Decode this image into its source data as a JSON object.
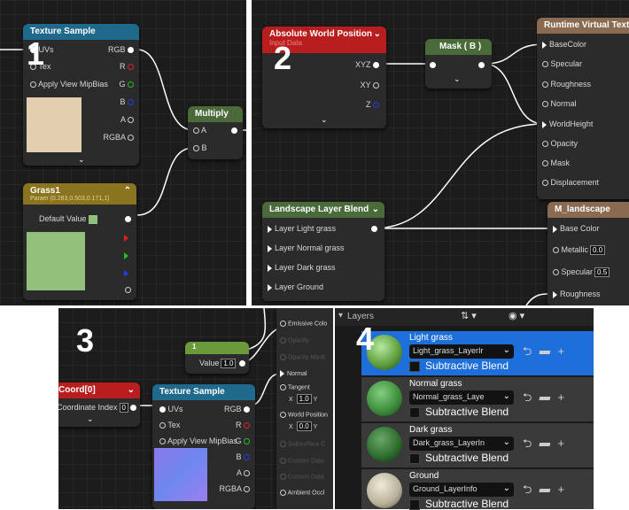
{
  "labels": {
    "p1": "1",
    "p2": "2",
    "p3": "3",
    "p4": "4"
  },
  "panel1": {
    "texture_sample": {
      "title": "Texture Sample",
      "inputs": [
        "UVs",
        "Tex",
        "Apply View MipBias"
      ],
      "outputs": [
        "RGB",
        "R",
        "G",
        "B",
        "A",
        "RGBA"
      ]
    },
    "multiply": {
      "title": "Multiply",
      "inputs": [
        "A",
        "B"
      ]
    },
    "grass1": {
      "title": "Grass1",
      "subtitle": "Param (0.283,0.503,0.171,1)",
      "default_label": "Default Value"
    }
  },
  "panel2": {
    "abs_world_pos": {
      "title": "Absolute World Position",
      "subtitle": "Input Data",
      "outputs": [
        "XYZ",
        "XY",
        "Z"
      ]
    },
    "mask": {
      "title": "Mask ( B )"
    },
    "rvt": {
      "title": "Runtime Virtual Texture",
      "pins": [
        "BaseColor",
        "Specular",
        "Roughness",
        "Normal",
        "WorldHeight",
        "Opacity",
        "Mask",
        "Displacement"
      ]
    },
    "llb": {
      "title": "Landscape Layer Blend",
      "pins": [
        "Layer Light grass",
        "Layer Normal grass",
        "Layer Dark grass",
        "Layer Ground"
      ]
    },
    "mlandscape": {
      "title": "M_landscape",
      "base_color": "Base Color",
      "metallic": "Metallic",
      "metallic_value": "0.0",
      "specular": "Specular",
      "specular_value": "0.5",
      "roughness": "Roughness"
    }
  },
  "panel3": {
    "coord": {
      "title": "Coord[0]",
      "index_label": "Coordinate Index",
      "index_value": "0"
    },
    "constant": {
      "title": "1",
      "value_label": "Value",
      "value": "1.0"
    },
    "texture_sample": {
      "title": "Texture Sample",
      "inputs": [
        "UVs",
        "Tex",
        "Apply View MipBias"
      ],
      "outputs": [
        "RGB",
        "R",
        "G",
        "B",
        "A",
        "RGBA"
      ]
    },
    "material_pins": {
      "emissive": "Emissive Colo",
      "opacity": "Opacity",
      "opacity_mask": "Opacity Mask",
      "normal": "Normal",
      "tangent": "Tangent",
      "tangent_x": "1.0",
      "world_position": "World Position",
      "wp_x": "0.0",
      "subsurface": "Subsurface C",
      "custom1": "Custom Data",
      "custom2": "Custom Data",
      "ambient": "Ambient Occl"
    }
  },
  "panel4": {
    "header": "Layers",
    "subtractive_label": "Subtractive Blend",
    "layers": [
      {
        "name": "Light grass",
        "info": "Light_grass_LayerIr"
      },
      {
        "name": "Normal grass",
        "info": "Normal_grass_Laye"
      },
      {
        "name": "Dark grass",
        "info": "Dark_grass_LayerIn"
      },
      {
        "name": "Ground",
        "info": "Ground_LayerInfo"
      }
    ]
  },
  "colors": {
    "texture_header": "#1f6a8c",
    "multiply_header": "#4a6a3a",
    "grass_header": "#8a7420",
    "abs_header": "#b81e1e",
    "mask_header": "#4a6a3a",
    "rvt_header": "#8a6a50",
    "llb_header": "#4a6a3a",
    "coord_header": "#b81e1e",
    "constant_header": "#6a9a3a",
    "selected_layer": "#1e6fd9",
    "grass_swatch": "#90c07a"
  }
}
